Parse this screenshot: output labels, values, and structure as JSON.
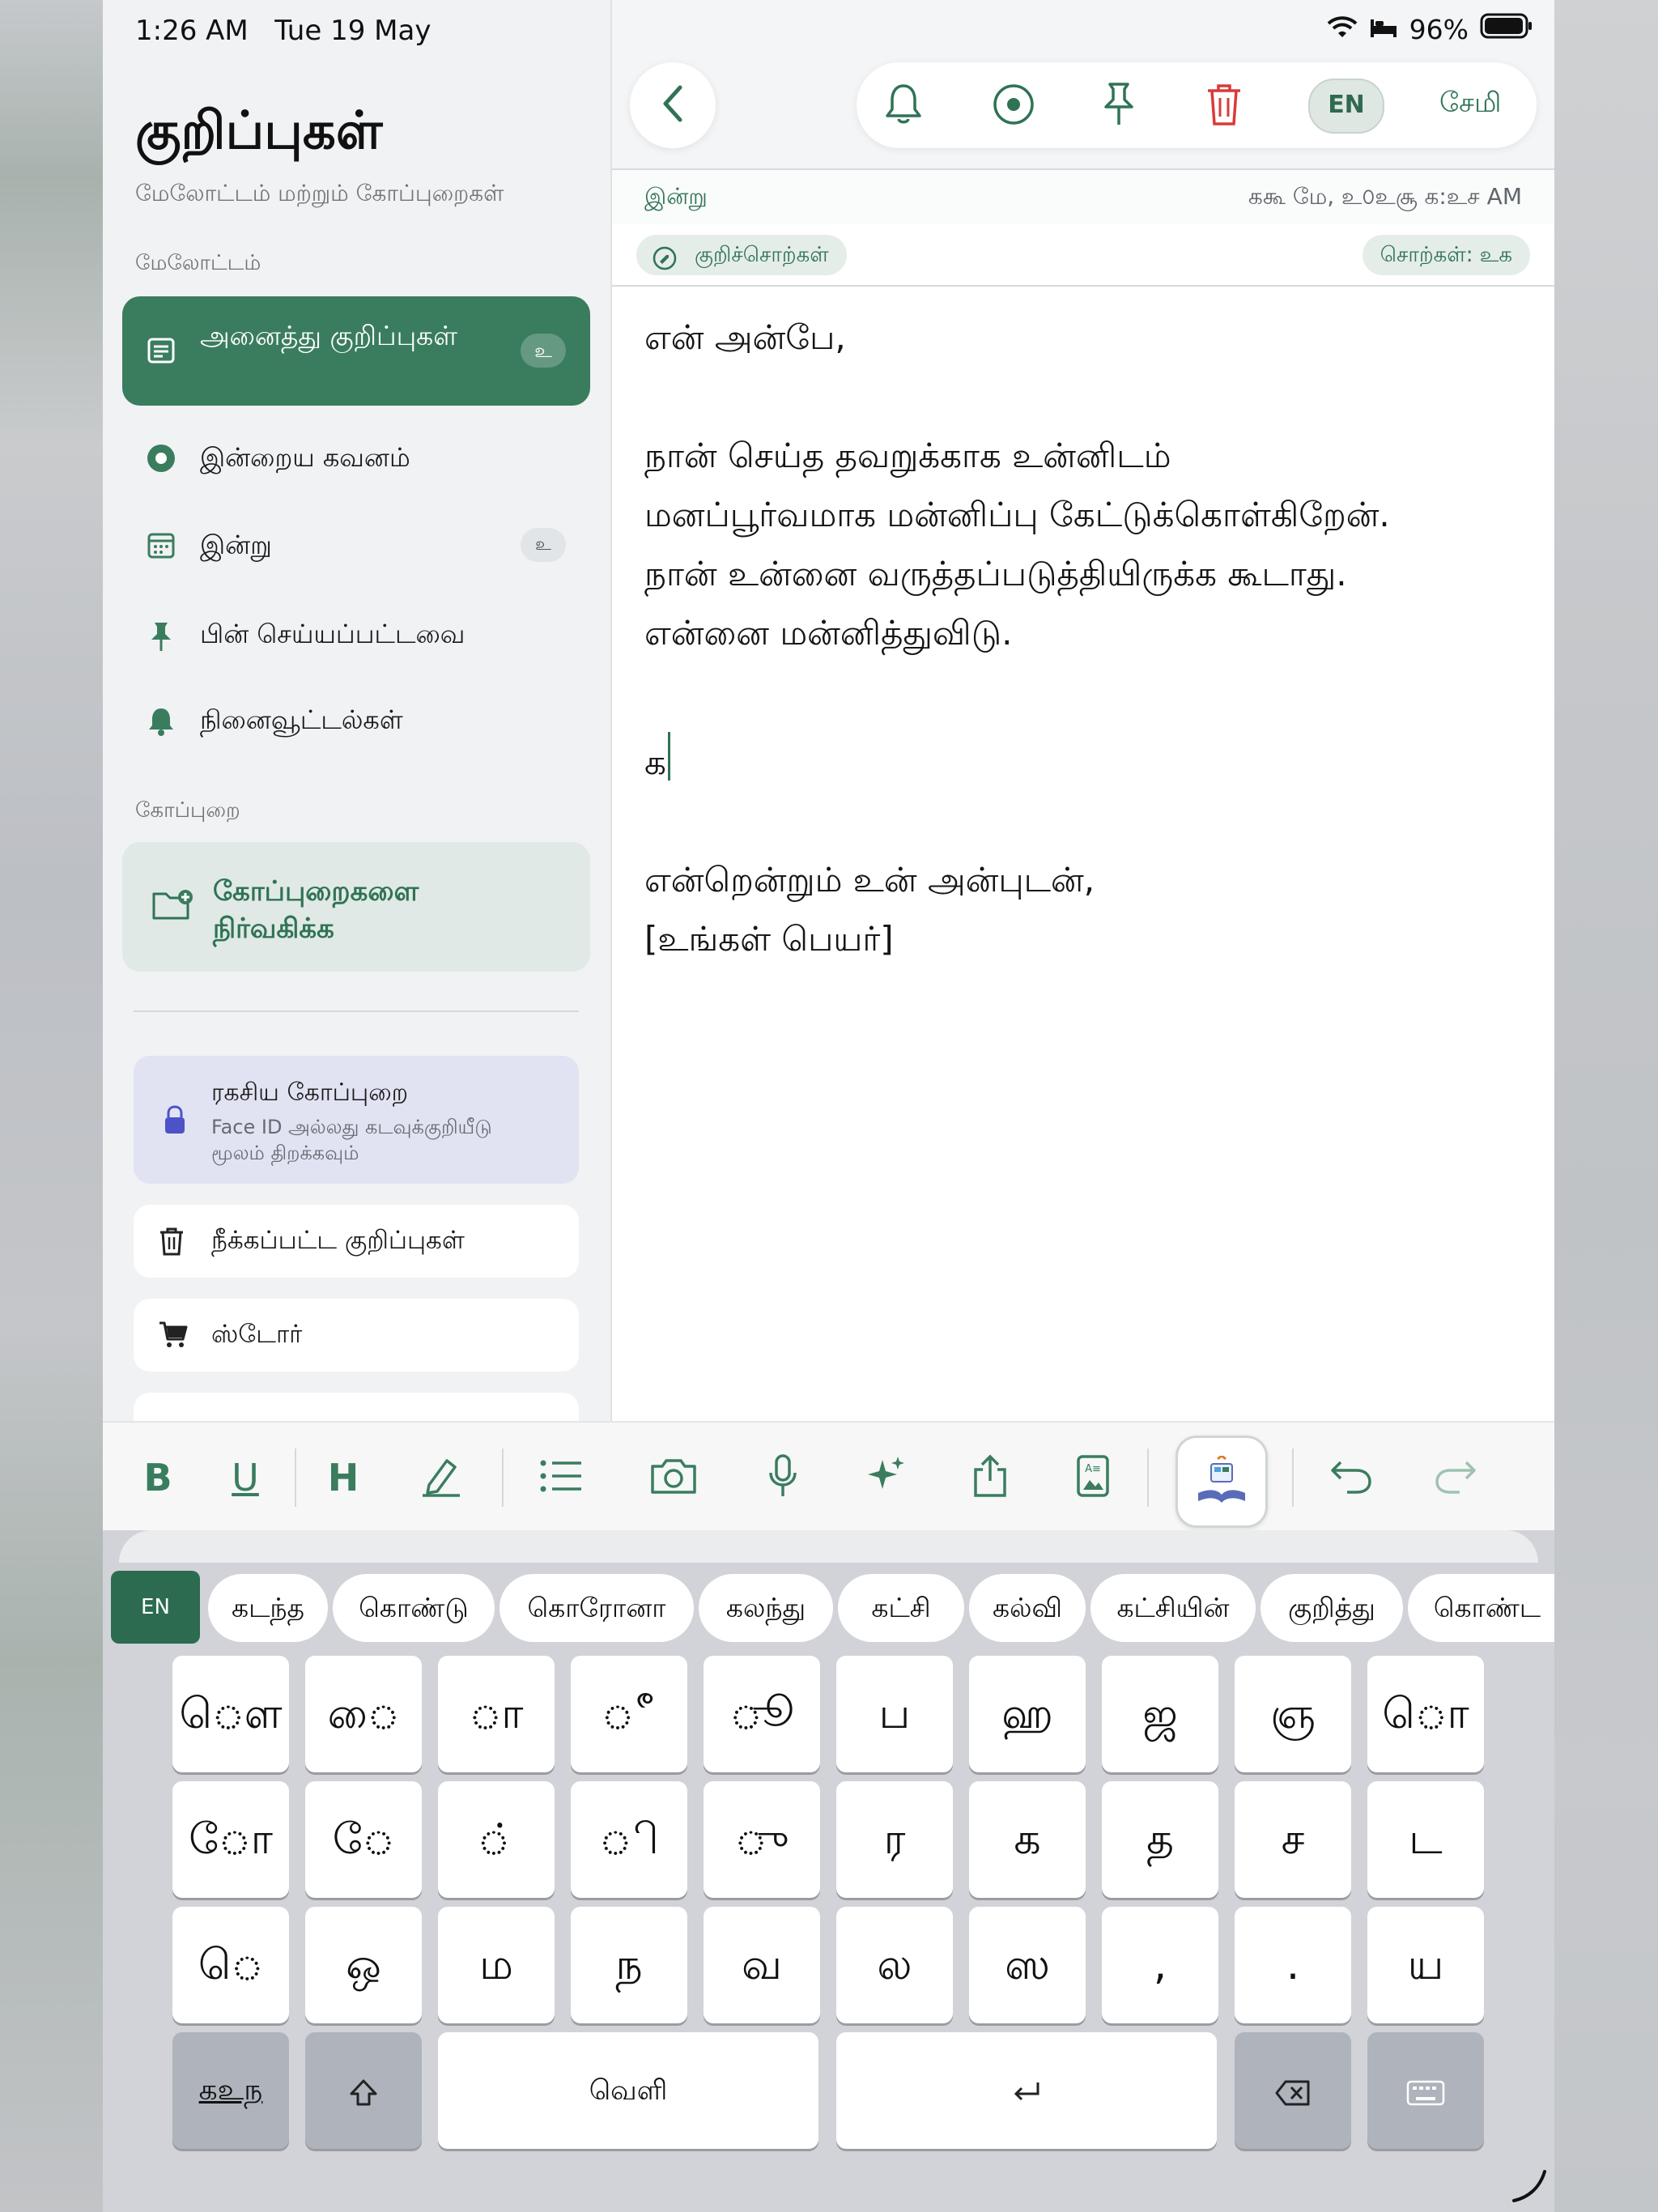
{
  "status": {
    "time": "1:26 AM",
    "date": "Tue 19 May",
    "battery": "96%"
  },
  "sidebar": {
    "title": "குறிப்புகள்",
    "subtitle": "மேலோட்டம் மற்றும் கோப்புறைகள்",
    "overview_label": "மேலோட்டம்",
    "all_notes": {
      "label": "அனைத்து குறிப்புகள்",
      "count": "உ"
    },
    "items": [
      {
        "label": "இன்றைய கவனம்",
        "icon": "focus-icon"
      },
      {
        "label": "இன்று",
        "icon": "calendar-icon",
        "count": "உ"
      },
      {
        "label": "பின் செய்யப்பட்டவை",
        "icon": "pin-icon"
      },
      {
        "label": "நினைவூட்டல்கள்",
        "icon": "bell-icon"
      }
    ],
    "folder_label": "கோப்புறை",
    "manage_folders": "கோப்புறைகளை நிர்வகிக்க",
    "vault": {
      "title": "ரகசிய கோப்புறை",
      "subtitle": "Face ID அல்லது கடவுக்குறியீடு மூலம் திறக்கவும்"
    },
    "deleted": "நீக்கப்பட்ட குறிப்புகள்",
    "store": "ஸ்டோர்"
  },
  "toolbar": {
    "lang": "EN",
    "save_label": "சேமி"
  },
  "note": {
    "date_label": "இன்று",
    "timestamp": "ககூ மே, உ௦உசூ க:உச AM",
    "tags_label": "குறிச்சொற்கள்",
    "word_count": "சொற்கள்: உக",
    "lines": [
      "என் அன்பே,",
      "",
      "நான் செய்த தவறுக்காக உன்னிடம்",
      "மனப்பூர்வமாக மன்னிப்பு கேட்டுக்கொள்கிறேன்.",
      "நான் உன்னை வருத்தப்படுத்தியிருக்க கூடாது.",
      "என்னை மன்னித்துவிடு.",
      "",
      "க",
      "",
      "என்றென்றும் உன் அன்புடன்,",
      "[உங்கள் பெயர்]"
    ]
  },
  "format_bar": {
    "bold": "B",
    "underline": "U",
    "heading": "H"
  },
  "keyboard": {
    "lang": "EN",
    "suggestions": [
      "கடந்த",
      "கொண்டு",
      "கொரோனா",
      "கலந்து",
      "கட்சி",
      "கல்வி",
      "கட்சியின்",
      "குறித்து",
      "கொண்ட"
    ],
    "rows": [
      [
        "ௌ",
        "ை",
        "ா",
        "ீ",
        "ூ",
        "ப",
        "ஹ",
        "ஜ",
        "ஞ",
        "ொ"
      ],
      [
        "ோ",
        "ே",
        "்",
        "ி",
        "ு",
        "ர",
        "க",
        "த",
        "ச",
        "ட"
      ],
      [
        "ெ",
        "ஒ",
        "ம",
        "ந",
        "வ",
        "ல",
        "ஸ",
        ",",
        ".",
        "ய"
      ]
    ],
    "numbers_key": "கஉந",
    "space_label": "வெளி",
    "accent": "#3a7d5e"
  }
}
